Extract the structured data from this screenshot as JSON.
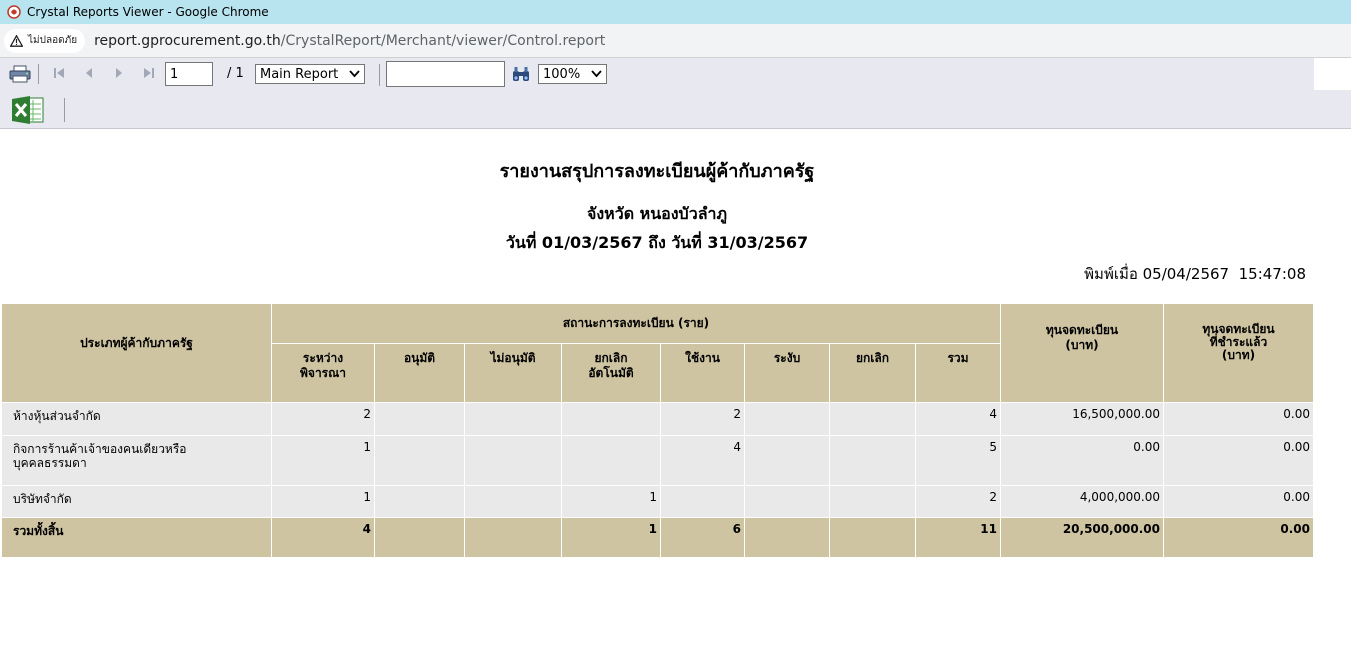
{
  "window": {
    "title": "Crystal Reports Viewer - Google Chrome"
  },
  "address_bar": {
    "security_label": "ไม่ปลอดภัย",
    "url_host": "report.gprocurement.go.th",
    "url_path": "/CrystalReport/Merchant/viewer/Control.report"
  },
  "toolbar": {
    "icons": [
      "printer-icon",
      "first-page-icon",
      "prev-page-icon",
      "next-page-icon",
      "last-page-icon",
      "binoculars-icon",
      "excel-export-icon"
    ],
    "current_page": "1",
    "total_pages": "/ 1",
    "report_select": "Main Report",
    "search_value": "",
    "zoom": "100%"
  },
  "report": {
    "title": "รายงานสรุปการลงทะเบียนผู้ค้ากับภาครัฐ",
    "province": "จังหวัด หนองบัวลำภู",
    "date_range": "วันที่ 01/03/2567 ถึง วันที่ 31/03/2567",
    "printed_at": "พิมพ์เมื่อ 05/04/2567  15:47:08",
    "table": {
      "header_category": "ประเภทผู้ค้ากับภาครัฐ",
      "header_status_group": "สถานะการลงทะเบียน (ราย)",
      "header_capital": "ทุนจดทะเบียน\n(บาท)",
      "header_paid_capital": "ทุนจดทะเบียน\nที่ชำระแล้ว\n(บาท)",
      "status_columns": [
        "ระหว่าง\nพิจารณา",
        "อนุมัติ",
        "ไม่อนุมัติ",
        "ยกเลิก\nอัตโนมัติ",
        "ใช้งาน",
        "ระงับ",
        "ยกเลิก",
        "รวม"
      ],
      "rows": [
        {
          "category": "ห้างหุ้นส่วนจำกัด",
          "cells": [
            "2",
            "",
            "",
            "",
            "2",
            "",
            "",
            "4"
          ],
          "capital": "16,500,000.00",
          "paid": "0.00"
        },
        {
          "category": "กิจการร้านค้าเจ้าของคนเดียวหรือ\nบุคคลธรรมดา",
          "cells": [
            "1",
            "",
            "",
            "",
            "4",
            "",
            "",
            "5"
          ],
          "capital": "0.00",
          "paid": "0.00"
        },
        {
          "category": "บริษัทจำกัด",
          "cells": [
            "1",
            "",
            "",
            "1",
            "",
            "",
            "",
            "2"
          ],
          "capital": "4,000,000.00",
          "paid": "0.00"
        }
      ],
      "total": {
        "category": "รวมทั้งสิ้น",
        "cells": [
          "4",
          "",
          "",
          "1",
          "6",
          "",
          "",
          "11"
        ],
        "capital": "20,500,000.00",
        "paid": "0.00"
      }
    }
  }
}
